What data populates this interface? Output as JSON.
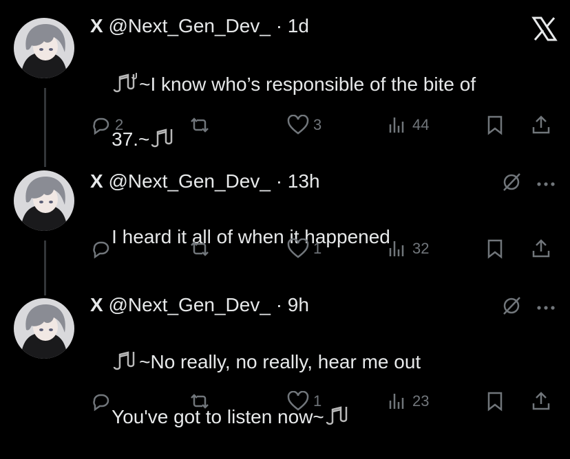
{
  "app": {
    "logo": "x-logo-icon"
  },
  "tweets": [
    {
      "name": "X",
      "handle": "@Next_Gen_Dev_",
      "sep": "·",
      "time": "1d",
      "line1": "~I know who’s responsible of the bite of",
      "line2": "37.~",
      "actions": {
        "replies": "2",
        "retweets": "",
        "likes": "3",
        "views": "44"
      }
    },
    {
      "name": "X",
      "handle": "@Next_Gen_Dev_",
      "sep": "·",
      "time": "13h",
      "line1": "I heard it all of when it happened",
      "actions": {
        "replies": "",
        "retweets": "",
        "likes": "1",
        "views": "32"
      }
    },
    {
      "name": "X",
      "handle": "@Next_Gen_Dev_",
      "sep": "·",
      "time": "9h",
      "line1": "~No really, no really, hear me out",
      "line2": "You've got to listen now~",
      "actions": {
        "replies": "",
        "retweets": "",
        "likes": "1",
        "views": "23"
      }
    }
  ],
  "colors": {
    "background": "#000000",
    "text": "#e7e9ea",
    "muted": "#71767b",
    "thread_line": "#333639"
  }
}
